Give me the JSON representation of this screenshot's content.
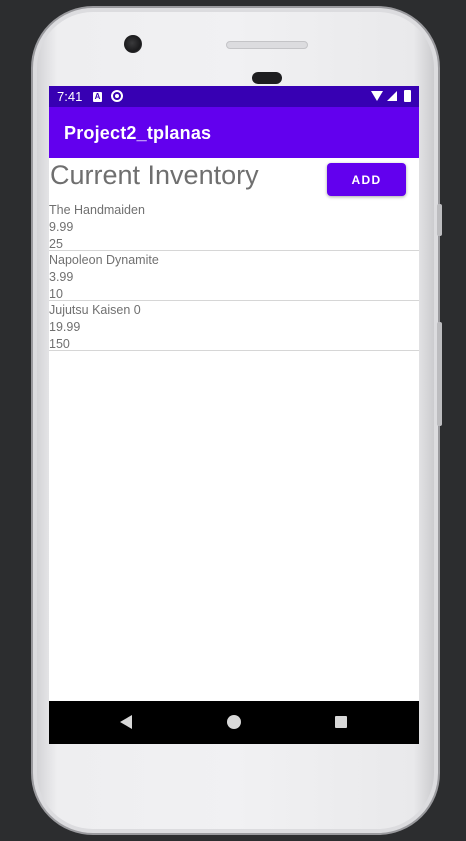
{
  "status_bar": {
    "time": "7:41",
    "icons": [
      "notification-a-icon",
      "sync-icon",
      "wifi-icon",
      "signal-icon",
      "battery-icon"
    ]
  },
  "app_bar": {
    "title": "Project2_tplanas",
    "color": "#6200ee"
  },
  "main": {
    "heading": "Current Inventory",
    "add_label": "ADD",
    "items": [
      {
        "name": "The Handmaiden",
        "price": "9.99",
        "quantity": "25"
      },
      {
        "name": "Napoleon Dynamite",
        "price": "3.99",
        "quantity": "10"
      },
      {
        "name": "Jujutsu Kaisen 0",
        "price": "19.99",
        "quantity": "150"
      }
    ]
  },
  "nav_bar": {
    "icons": [
      "back-icon",
      "home-icon",
      "recents-icon"
    ]
  },
  "colors": {
    "status_bar": "#3700b3",
    "primary": "#6200ee"
  }
}
